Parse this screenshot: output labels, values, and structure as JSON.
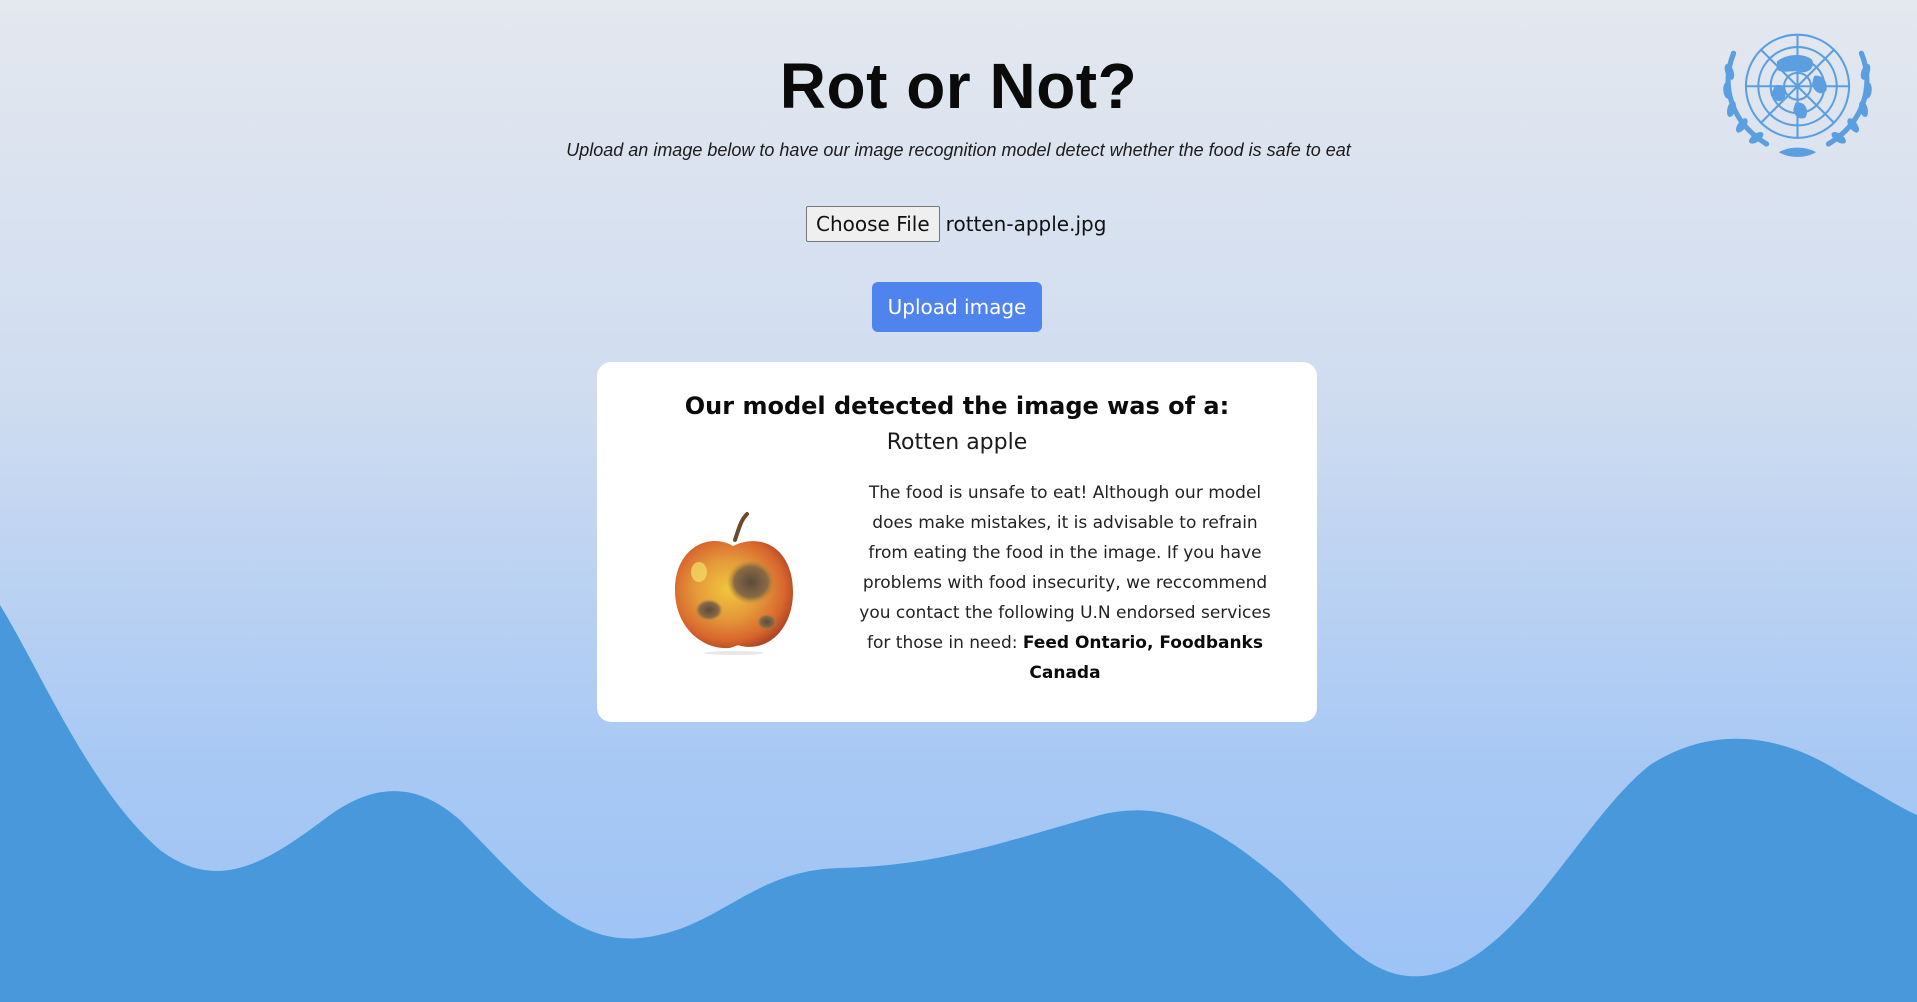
{
  "header": {
    "title": "Rot or Not?",
    "subtitle": "Upload an image below to have our image recognition model detect whether the food is safe to eat"
  },
  "upload_form": {
    "choose_file_label": "Choose File",
    "selected_file": "rotten-apple.jpg",
    "upload_button_label": "Upload image"
  },
  "result": {
    "heading": "Our model detected the image was of a:",
    "label": "Rotten apple",
    "image_subject": "rotten-apple-photo",
    "advice_text": "The food is unsafe to eat! Although our model does make mistakes, it is advisable to refrain from eating the food in the image. If you have problems with food insecurity, we reccommend you contact the following U.N endorsed services for those in need: ",
    "services_text": "Feed Ontario, Foodbanks Canada"
  },
  "branding": {
    "logo": "united-nations-emblem"
  },
  "colors": {
    "primary_button": "#4f84ef",
    "wave": "#4898db",
    "logo": "#5b9fe0",
    "card_background": "#ffffff"
  }
}
